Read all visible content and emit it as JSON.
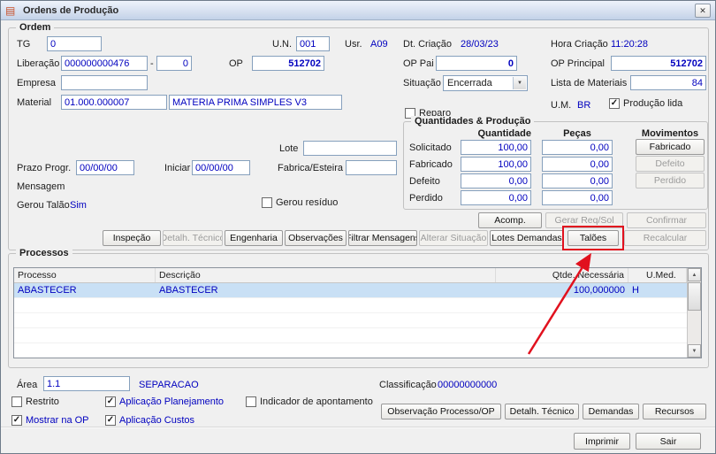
{
  "window": {
    "title": "Ordens de Produção"
  },
  "icons": {
    "app": "▤",
    "close": "✕",
    "check": "✓",
    "dropdown": "▼",
    "scroll_up": "▲",
    "scroll_down": "▼"
  },
  "colors": {
    "value_text": "#0000bf",
    "row_selection": "#c9e0f5",
    "annotation": "#e1111e"
  },
  "ordem": {
    "legend": "Ordem",
    "tg_label": "TG",
    "tg_value": "0",
    "un_label": "U.N.",
    "un_value": "001",
    "usr_label": "Usr.",
    "usr_value": "A09",
    "dt_criacao_label": "Dt. Criação",
    "dt_criacao_value": "28/03/23",
    "hora_criacao_label": "Hora Criação",
    "hora_criacao_value": "11:20:28",
    "liberacao_label": "Liberação",
    "liberacao_value": "000000000476",
    "liberacao_sep": "-",
    "liberacao_seq": "0",
    "op_label": "OP",
    "op_value": "512702",
    "op_pai_label": "OP Pai",
    "op_pai_value": "0",
    "op_principal_label": "OP Principal",
    "op_principal_value": "512702",
    "empresa_label": "Empresa",
    "empresa_value": "",
    "situacao_label": "Situação",
    "situacao_value": "Encerrada",
    "lista_materiais_label": "Lista de Materiais",
    "lista_materiais_value": "84",
    "material_label": "Material",
    "material_code": "01.000.000007",
    "material_descricao": "MATERIA PRIMA SIMPLES V3",
    "reparo_label": "Reparo",
    "um_label": "U.M.",
    "um_value": "BR",
    "producao_lida_label": "Produção lida",
    "lote_label": "Lote",
    "lote_value": "",
    "prazo_progr_label": "Prazo Progr.",
    "prazo_progr_value": "00/00/00",
    "iniciar_label": "Iniciar",
    "iniciar_value": "00/00/00",
    "fabrica_esteira_label": "Fabrica/Esteira",
    "fabrica_esteira_value": "",
    "mensagem_label": "Mensagem",
    "gerou_talao_label": "Gerou Talão",
    "gerou_talao_value": "Sim",
    "gerou_residuo_label": "Gerou resíduo"
  },
  "quantidades": {
    "legend": "Quantidades & Produção",
    "header_quantidade": "Quantidade",
    "header_pecas": "Peças",
    "header_movimentos": "Movimentos",
    "rows": [
      {
        "label": "Solicitado",
        "quantidade": "100,00",
        "pecas": "0,00"
      },
      {
        "label": "Fabricado",
        "quantidade": "100,00",
        "pecas": "0,00"
      },
      {
        "label": "Defeito",
        "quantidade": "0,00",
        "pecas": "0,00"
      },
      {
        "label": "Perdido",
        "quantidade": "0,00",
        "pecas": "0,00"
      }
    ],
    "mov_buttons": [
      {
        "label": "Fabricado",
        "enabled": true
      },
      {
        "label": "Defeito",
        "enabled": false
      },
      {
        "label": "Perdido",
        "enabled": false
      }
    ]
  },
  "actions": {
    "acomp": "Acomp.",
    "gerar_req_sol": "Gerar Req/Sol",
    "confirmar": "Confirmar",
    "row2": [
      {
        "label": "Inspeção",
        "enabled": true
      },
      {
        "label": "Detalh. Técnico",
        "enabled": false
      },
      {
        "label": "Engenharia",
        "enabled": true
      },
      {
        "label": "Observações",
        "enabled": true
      },
      {
        "label": "Filtrar Mensagens",
        "enabled": true
      },
      {
        "label": "Alterar Situação",
        "enabled": false
      },
      {
        "label": "Lotes Demandas",
        "enabled": true
      },
      {
        "label": "Talões",
        "enabled": true,
        "highlighted": true
      },
      {
        "label": "Recalcular",
        "enabled": false
      }
    ]
  },
  "processos": {
    "legend": "Processos",
    "columns": [
      "Processo",
      "Descrição",
      "Qtde. Necessária",
      "U.Med."
    ],
    "rows": [
      {
        "processo": "ABASTECER",
        "descricao": "ABASTECER",
        "qtde_necessaria": "100,000000",
        "umed": "H",
        "selected": true
      }
    ]
  },
  "detalhe": {
    "area_label": "Área",
    "area_value": "1.1",
    "area_descricao": "SEPARACAO",
    "classificacao_label": "Classificação",
    "classificacao_value": "00000000000",
    "restrito_label": "Restrito",
    "aplicacao_planejamento_label": "Aplicação Planejamento",
    "indicador_apontamento_label": "Indicador de apontamento",
    "mostrar_na_op_label": "Mostrar na OP",
    "aplicacao_custos_label": "Aplicação Custos",
    "buttons": [
      "Observação Processo/OP",
      "Detalh. Técnico",
      "Demandas",
      "Recursos"
    ]
  },
  "footer": {
    "imprimir": "Imprimir",
    "sair": "Sair"
  }
}
